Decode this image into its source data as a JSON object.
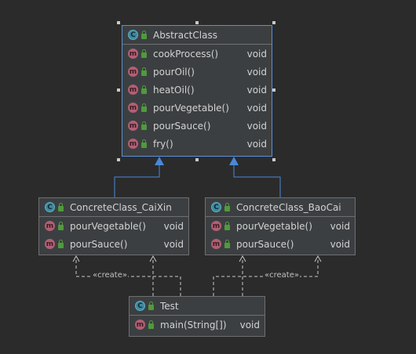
{
  "colors": {
    "background": "#2b2b2b",
    "box": "#3c3f41",
    "box_border": "#6f6f6f",
    "selection": "#5a8fd6",
    "class_icon": "#3d8aa1",
    "method_icon": "#b15f74",
    "public_lock": "#4f9a3c",
    "arrow": "#4a88d9",
    "dependency_line": "#c8c8c8"
  },
  "icons": {
    "class": "class-c-icon",
    "method": "method-m-icon",
    "visibility": "public-lock-icon"
  },
  "classes": {
    "abstract": {
      "title": "AbstractClass",
      "icon_letter": "C",
      "methods": [
        {
          "letter": "m",
          "name": "cookProcess()",
          "type": "void"
        },
        {
          "letter": "m",
          "name": "pourOil()",
          "type": "void"
        },
        {
          "letter": "m",
          "name": "heatOil()",
          "type": "void"
        },
        {
          "letter": "m",
          "name": "pourVegetable()",
          "type": "void"
        },
        {
          "letter": "m",
          "name": "pourSauce()",
          "type": "void"
        },
        {
          "letter": "m",
          "name": "fry()",
          "type": "void"
        }
      ]
    },
    "caixin": {
      "title": "ConcreteClass_CaiXin",
      "icon_letter": "C",
      "methods": [
        {
          "letter": "m",
          "name": "pourVegetable()",
          "type": "void"
        },
        {
          "letter": "m",
          "name": "pourSauce()",
          "type": "void"
        }
      ]
    },
    "baocai": {
      "title": "ConcreteClass_BaoCai",
      "icon_letter": "C",
      "methods": [
        {
          "letter": "m",
          "name": "pourVegetable()",
          "type": "void"
        },
        {
          "letter": "m",
          "name": "pourSauce()",
          "type": "void"
        }
      ]
    },
    "test": {
      "title": "Test",
      "icon_letter": "C",
      "methods": [
        {
          "letter": "m",
          "name": "main(String[])",
          "type": "void"
        }
      ]
    }
  },
  "relations": {
    "create_label_left": "«create»",
    "create_label_right": "«create»"
  }
}
